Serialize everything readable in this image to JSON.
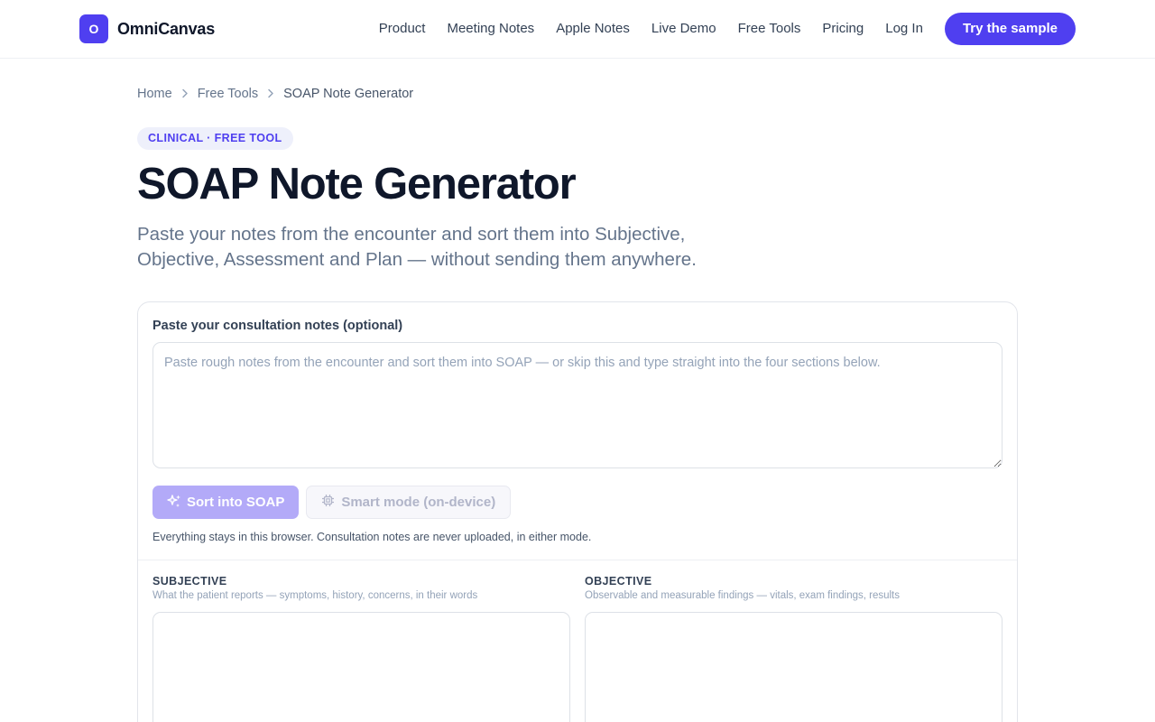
{
  "header": {
    "brand_letter": "O",
    "brand_name": "OmniCanvas",
    "nav": [
      "Product",
      "Meeting Notes",
      "Apple Notes",
      "Live Demo",
      "Free Tools",
      "Pricing",
      "Log In"
    ],
    "cta": "Try the sample",
    "accent_color": "#4f3ff0"
  },
  "breadcrumb": {
    "items": [
      "Home",
      "Free Tools",
      "SOAP Note Generator"
    ]
  },
  "badge": "CLINICAL · FREE TOOL",
  "title": "SOAP Note Generator",
  "lead": "Paste your notes from the encounter and sort them into Subjective, Objective, Assessment and Plan — without sending them anywhere.",
  "form": {
    "label": "Paste your consultation notes (optional)",
    "notes_value": "",
    "notes_placeholder": "Paste rough notes from the encounter and sort them into SOAP — or skip this and type straight into the four sections below.",
    "sort_button": "Sort into SOAP",
    "smart_button": "Smart mode (on-device)",
    "hint": "Everything stays in this browser. Consultation notes are never uploaded, in either mode."
  },
  "sections": [
    {
      "title": "SUBJECTIVE",
      "desc": "What the patient reports — symptoms, history, concerns, in their words"
    },
    {
      "title": "OBJECTIVE",
      "desc": "Observable and measurable findings — vitals, exam findings, results"
    }
  ],
  "icons": {
    "sort": "sparkles-icon",
    "smart": "chip-icon",
    "breadcrumb_sep": "chevron-right-icon"
  }
}
